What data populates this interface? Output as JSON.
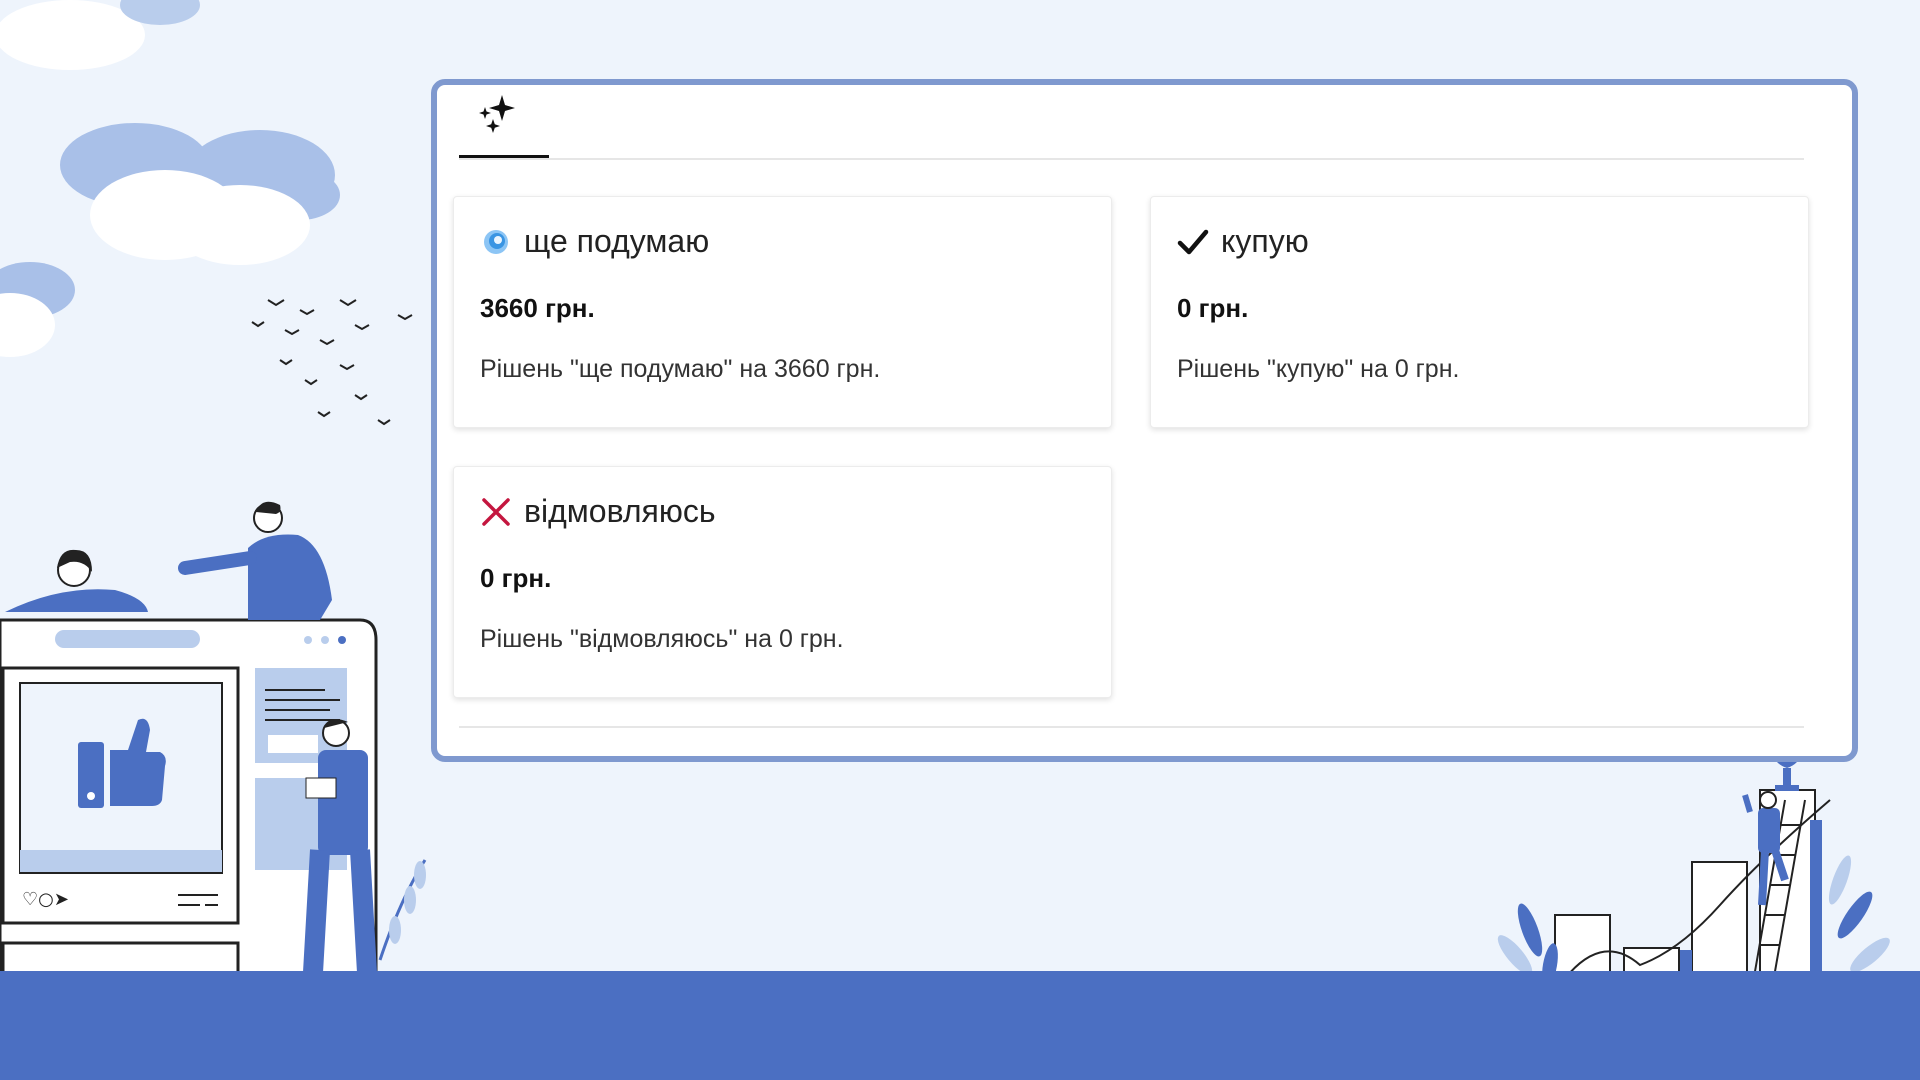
{
  "tabs": [
    {
      "icon": "sparkles-icon",
      "active": true
    }
  ],
  "cards": [
    {
      "icon": "swirl-icon",
      "title": "ще подумаю",
      "amount": "3660 грн.",
      "description": "Рішень \"ще подумаю\" на 3660 грн."
    },
    {
      "icon": "checkmark-icon",
      "title": "купую",
      "amount": "0 грн.",
      "description": "Рішень \"купую\" на 0 грн."
    },
    {
      "icon": "cross-icon",
      "title": "відмовляюсь",
      "amount": "0 грн.",
      "description": "Рішень \"відмовляюсь\" на 0 грн."
    }
  ],
  "colors": {
    "background": "#eef4fc",
    "ground": "#4b6fc2",
    "panel_border": "#7f99cf",
    "illustration_blue": "#4b6fc2",
    "cloud": "#b9cdec",
    "cross": "#c4163f",
    "swirl": "#3a95e3"
  }
}
